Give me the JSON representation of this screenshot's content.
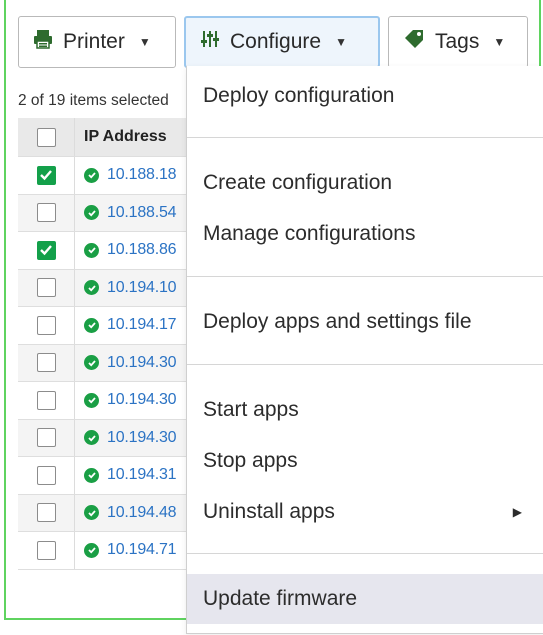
{
  "toolbar": {
    "printer_label": "Printer",
    "configure_label": "Configure",
    "tags_label": "Tags"
  },
  "status": {
    "selection_text": "2 of 19 items selected"
  },
  "table": {
    "header": {
      "ip": "IP Address"
    },
    "rows": [
      {
        "ip": "10.188.18",
        "checked": true
      },
      {
        "ip": "10.188.54",
        "checked": false
      },
      {
        "ip": "10.188.86",
        "checked": true
      },
      {
        "ip": "10.194.10",
        "checked": false
      },
      {
        "ip": "10.194.17",
        "checked": false
      },
      {
        "ip": "10.194.30",
        "checked": false
      },
      {
        "ip": "10.194.30",
        "checked": false
      },
      {
        "ip": "10.194.30",
        "checked": false
      },
      {
        "ip": "10.194.31",
        "checked": false
      },
      {
        "ip": "10.194.48",
        "checked": false
      },
      {
        "ip": "10.194.71",
        "checked": false
      }
    ]
  },
  "menu": {
    "deploy_configuration": "Deploy configuration",
    "create_configuration": "Create configuration",
    "manage_configurations": "Manage configurations",
    "deploy_apps_settings": "Deploy apps and settings file",
    "start_apps": "Start apps",
    "stop_apps": "Stop apps",
    "uninstall_apps": "Uninstall apps",
    "update_firmware": "Update firmware"
  },
  "colors": {
    "accent_green": "#13a04a",
    "link_blue": "#2b73c4",
    "frame_green": "#5fd35f",
    "menu_hover": "#e6e6ee"
  },
  "icons": {
    "printer": "printer-icon",
    "configure": "sliders-icon",
    "tags": "tag-icon",
    "status_ok": "check-circle-icon",
    "submenu": "chevron-right-icon"
  }
}
